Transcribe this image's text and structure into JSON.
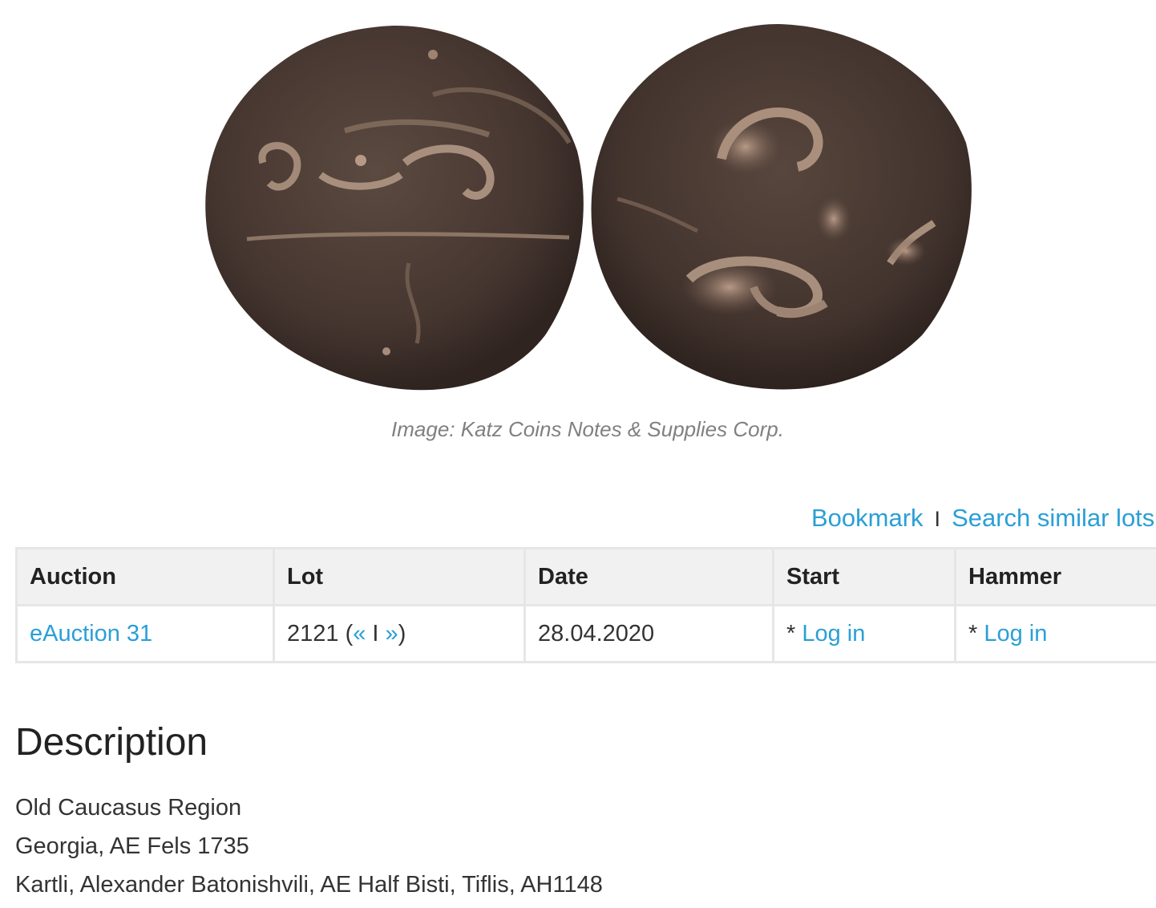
{
  "image": {
    "alt_icon": "coin-photo",
    "coin_color": "#4a3a31",
    "caption": "Image: Katz Coins Notes & Supplies Corp."
  },
  "actions": {
    "bookmark": "Bookmark",
    "separator": "I",
    "search_similar": "Search similar lots"
  },
  "table": {
    "headers": {
      "auction": "Auction",
      "lot": "Lot",
      "date": "Date",
      "start": "Start",
      "hammer": "Hammer"
    },
    "row": {
      "auction": "eAuction 31",
      "lot_number": "2121 (",
      "prev": "«",
      "lot_sep": " I ",
      "next": "»",
      "lot_close": ")",
      "date": "28.04.2020",
      "start_prefix": "* ",
      "start_link": "Log in",
      "hammer_prefix": "* ",
      "hammer_link": "Log in"
    }
  },
  "description": {
    "title": "Description",
    "lines": [
      "Old Caucasus Region",
      "Georgia, AE Fels 1735",
      "Kartli, Alexander Batonishvili, AE Half Bisti, Tiflis, AH1148"
    ]
  },
  "colors": {
    "link": "#2a9fd6",
    "header_bg": "#f1f1f1",
    "border": "#e6e6e6"
  }
}
